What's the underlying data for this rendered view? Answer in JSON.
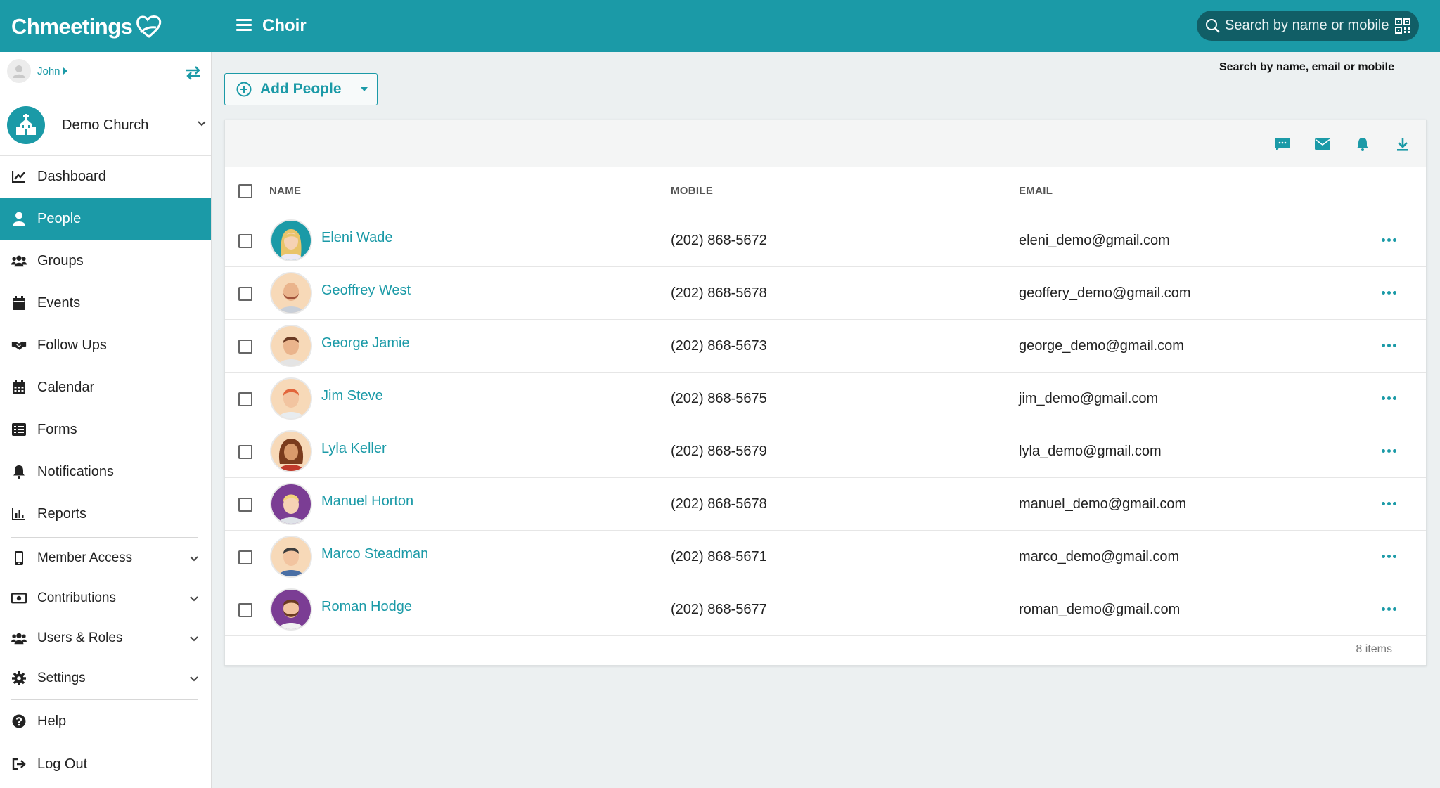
{
  "app": {
    "logo_text": "Chmeetings"
  },
  "header": {
    "title": "Choir",
    "search_placeholder": "Search by name or mobile"
  },
  "sidebar": {
    "user": "John",
    "church": "Demo Church",
    "items": [
      {
        "label": "Dashboard",
        "icon": "chart-line-icon",
        "active": false
      },
      {
        "label": "People",
        "icon": "person-icon",
        "active": true
      },
      {
        "label": "Groups",
        "icon": "users-group-icon",
        "active": false
      },
      {
        "label": "Events",
        "icon": "calendar-icon",
        "active": false
      },
      {
        "label": "Follow Ups",
        "icon": "handshake-icon",
        "active": false
      },
      {
        "label": "Calendar",
        "icon": "calendar-grid-icon",
        "active": false
      },
      {
        "label": "Forms",
        "icon": "form-list-icon",
        "active": false
      },
      {
        "label": "Notifications",
        "icon": "bell-icon",
        "active": false
      },
      {
        "label": "Reports",
        "icon": "bar-chart-icon",
        "active": false
      },
      {
        "label": "Member Access",
        "icon": "mobile-icon",
        "expandable": true
      },
      {
        "label": "Contributions",
        "icon": "money-icon",
        "expandable": true
      },
      {
        "label": "Users & Roles",
        "icon": "users-group-icon",
        "expandable": true
      },
      {
        "label": "Settings",
        "icon": "gear-icon",
        "expandable": true
      },
      {
        "label": "Help",
        "icon": "question-icon",
        "active": false
      },
      {
        "label": "Log Out",
        "icon": "logout-icon",
        "active": false
      }
    ]
  },
  "main": {
    "add_button_label": "Add People",
    "search_label": "Search by name, email or mobile",
    "search_value": "",
    "toolbar_icons": [
      "sms-icon",
      "email-icon",
      "bell-icon",
      "download-icon"
    ],
    "columns": [
      "NAME",
      "MOBILE",
      "EMAIL"
    ],
    "rows": [
      {
        "name": "Eleni Wade",
        "mobile": "(202) 868-5672",
        "email": "eleni_demo@gmail.com"
      },
      {
        "name": "Geoffrey West",
        "mobile": "(202) 868-5678",
        "email": "geoffery_demo@gmail.com"
      },
      {
        "name": "George Jamie",
        "mobile": "(202) 868-5673",
        "email": "george_demo@gmail.com"
      },
      {
        "name": "Jim Steve",
        "mobile": "(202) 868-5675",
        "email": "jim_demo@gmail.com"
      },
      {
        "name": "Lyla Keller",
        "mobile": "(202) 868-5679",
        "email": "lyla_demo@gmail.com"
      },
      {
        "name": "Manuel Horton",
        "mobile": "(202) 868-5678",
        "email": "manuel_demo@gmail.com"
      },
      {
        "name": "Marco Steadman",
        "mobile": "(202) 868-5671",
        "email": "marco_demo@gmail.com"
      },
      {
        "name": "Roman Hodge",
        "mobile": "(202) 868-5677",
        "email": "roman_demo@gmail.com"
      }
    ],
    "items_count": "8 items"
  },
  "colors": {
    "accent": "#1b9aa7",
    "accent_dark": "#115e66",
    "background": "#ecf0f1"
  }
}
